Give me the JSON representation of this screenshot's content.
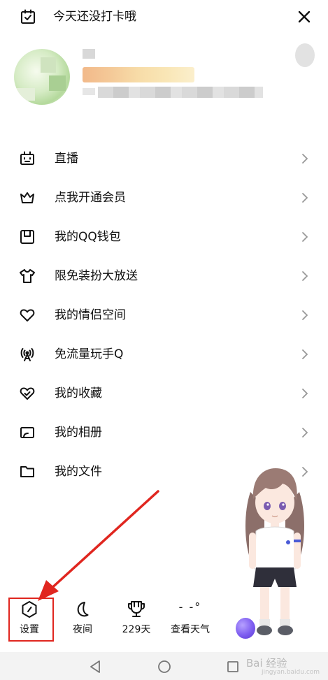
{
  "header": {
    "checkin_text": "今天还没打卡哦",
    "checkin_icon": "calendar-check-icon",
    "close_icon": "close-icon"
  },
  "profile": {
    "avatar": "avatar-blurred",
    "name_blurred": true,
    "signature_blurred": true
  },
  "menu": [
    {
      "label": "直播",
      "icon": "tv-icon"
    },
    {
      "label": "点我开通会员",
      "icon": "crown-icon"
    },
    {
      "label": "我的QQ钱包",
      "icon": "wallet-icon"
    },
    {
      "label": "限免装扮大放送",
      "icon": "tshirt-icon"
    },
    {
      "label": "我的情侣空间",
      "icon": "heart-icon"
    },
    {
      "label": "免流量玩手Q",
      "icon": "signal-tower-icon"
    },
    {
      "label": "我的收藏",
      "icon": "favorite-heart-icon"
    },
    {
      "label": "我的相册",
      "icon": "album-icon"
    },
    {
      "label": "我的文件",
      "icon": "folder-icon"
    }
  ],
  "bottom_bar": {
    "settings_label": "设置",
    "night_label": "夜间",
    "days_label": "229天",
    "weather_icon_text": "- -°",
    "weather_label": "查看天气"
  },
  "annotation": {
    "highlight_color": "#e0261f"
  },
  "nav": {
    "back_icon": "triangle-back-icon",
    "home_icon": "circle-home-icon",
    "recent_icon": "square-recent-icon"
  },
  "watermark": {
    "text": "Bai 经验",
    "sub": "jingyan.baidu.com"
  }
}
